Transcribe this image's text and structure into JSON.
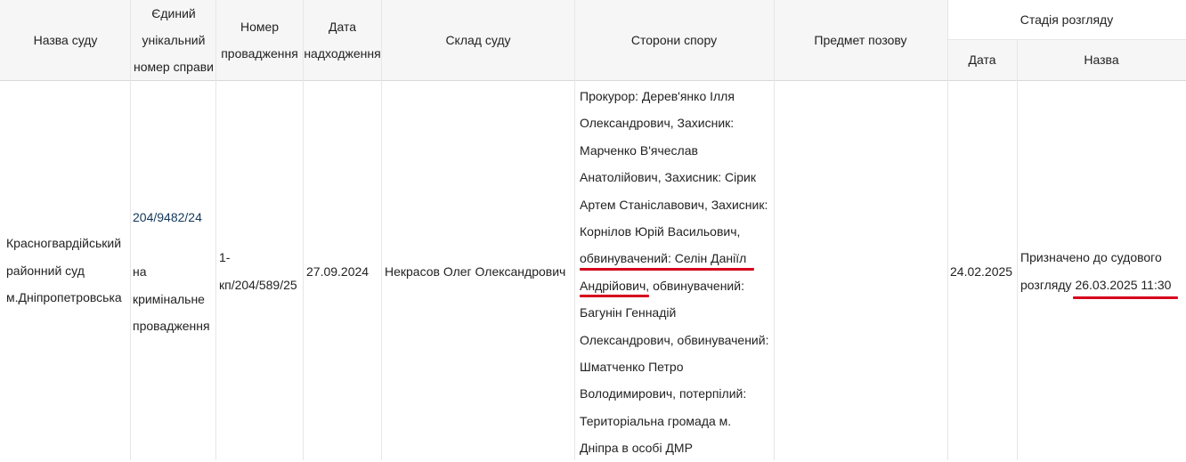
{
  "headers": {
    "court_name": "Назва суду",
    "case_number_line1": "Єдиний",
    "case_number_line2": "унікальний",
    "case_number_line3": "номер справи",
    "proceeding_number_line1": "Номер",
    "proceeding_number_line2": "провадження",
    "received_date_line1": "Дата",
    "received_date_line2": "надходження",
    "court_composition": "Склад суду",
    "parties": "Сторони спору",
    "claim_subject": "Предмет позову",
    "stage": "Стадія розгляду",
    "stage_date": "Дата",
    "stage_name": "Назва"
  },
  "row": {
    "court_name_lines": [
      "Красногвардійський",
      "районний суд",
      "м.Дніпропетровська"
    ],
    "case_number_link": "204/9482/24",
    "case_type_lines": [
      "на",
      "кримінальне",
      "провадження"
    ],
    "proceeding_number_lines": [
      "1-",
      "кп/204/589/25"
    ],
    "received_date": "27.09.2024",
    "court_composition": "Некрасов Олег Олександрович",
    "parties_lines": [
      "Прокурор: Дерев'янко Ілля",
      "Олександрович, Захисник:",
      "Марченко В'ячеслав",
      "Анатолійович, Захисник: Сірик",
      "Артем Станіславович, Захисник:",
      "Корнілов Юрій Васильович,",
      "обвинувачений: Селін Даніїл",
      "Андрійович, обвинувачений:",
      "Багунін Геннадій",
      "Олександрович, обвинувачений:",
      "Шматченко Петро",
      "Володимирович, потерпілий:",
      "Територіальна громада м.",
      "Дніпра в особі ДМР"
    ],
    "claim_subject": "",
    "stage_date": "24.02.2025",
    "stage_name_line1": "Призначено до судового",
    "stage_name_line2_prefix": "розгляду",
    "stage_name_line2_datetime": "26.03.2025 11:30"
  },
  "colors": {
    "header_bg": "#f6f6f6",
    "link": "#12375c",
    "highlight_underline": "#d6001c"
  }
}
